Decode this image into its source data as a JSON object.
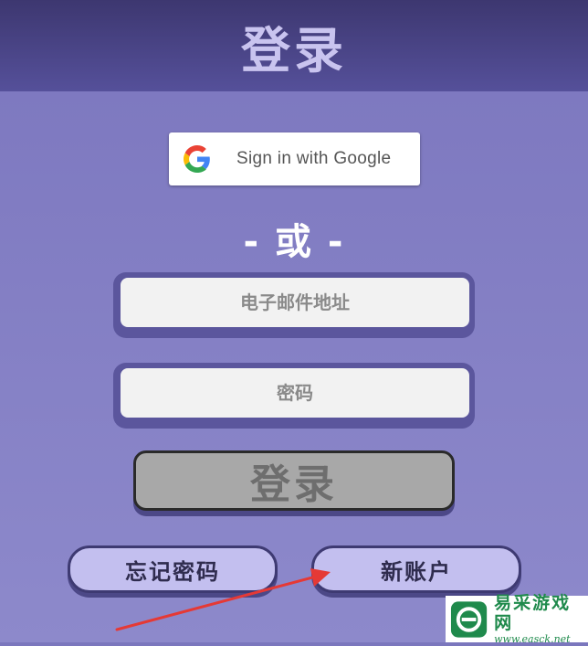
{
  "header": {
    "title": "登录"
  },
  "google_button": {
    "label": "Sign in with Google",
    "icon": "google-g-icon"
  },
  "divider": {
    "label": "- 或 -"
  },
  "form": {
    "email": {
      "placeholder": "电子邮件地址",
      "value": ""
    },
    "password": {
      "placeholder": "密码",
      "value": ""
    }
  },
  "login_button": {
    "label": "登录"
  },
  "forgot_password_button": {
    "label": "忘记密码"
  },
  "new_account_button": {
    "label": "新账户"
  },
  "annotation": {
    "icon": "red-arrow-icon",
    "color": "#e53935"
  },
  "watermark": {
    "title": "易采游戏网",
    "url": "www.easck.net"
  },
  "colors": {
    "header": "#3d3770",
    "background": "#7b77bd",
    "accent_button": "#c3bfef",
    "login_button": "#a8a8a8"
  }
}
